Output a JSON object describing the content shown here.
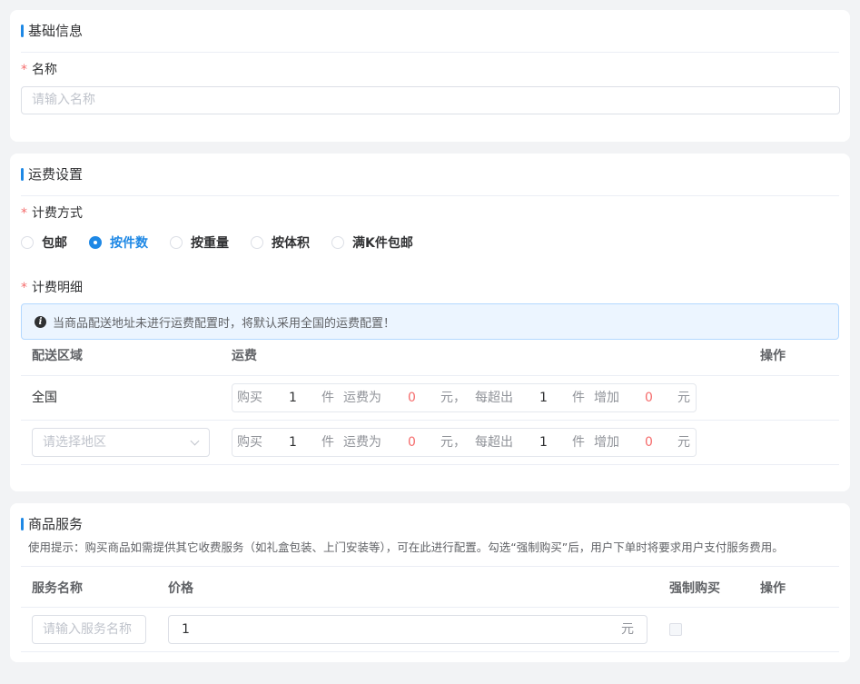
{
  "basic": {
    "title": "基础信息",
    "name_label": "名称",
    "required_mark": "*",
    "name_placeholder": "请输入名称"
  },
  "shipping": {
    "title": "运费设置",
    "billing_method_label": "计费方式",
    "billing_options": [
      {
        "label": "包邮",
        "checked": false
      },
      {
        "label": "按件数",
        "checked": true
      },
      {
        "label": "按重量",
        "checked": false
      },
      {
        "label": "按体积",
        "checked": false
      },
      {
        "label": "满K件包邮",
        "checked": false
      }
    ],
    "detail_label": "计费明细",
    "notice": "当商品配送地址未进行运费配置时，将默认采用全国的运费配置！",
    "table_headers": {
      "region": "配送区域",
      "fee": "运费",
      "action": "操作"
    },
    "rows": [
      {
        "region": "全国",
        "buy_label": "购买",
        "buy_qty": "1",
        "unit": "件",
        "fee_label": "运费为",
        "fee": "0",
        "currency": "元，",
        "each_over_label": "每超出",
        "over_qty": "1",
        "over_unit": "件",
        "add_label": "增加",
        "add_fee": "0",
        "add_currency": "元"
      },
      {
        "region_placeholder": "请选择地区",
        "buy_label": "购买",
        "buy_qty": "1",
        "unit": "件",
        "fee_label": "运费为",
        "fee": "0",
        "currency": "元，",
        "each_over_label": "每超出",
        "over_qty": "1",
        "over_unit": "件",
        "add_label": "增加",
        "add_fee": "0",
        "add_currency": "元"
      }
    ],
    "accent_color": "#1e88e5",
    "value_color": "#f56c6c"
  },
  "services": {
    "title": "商品服务",
    "tip": "使用提示：购买商品如需提供其它收费服务（如礼盒包装、上门安装等），可在此进行配置。勾选“强制购买”后，用户下单时将要求用户支付服务费用。",
    "table_headers": {
      "name": "服务名称",
      "price": "价格",
      "force": "强制购买",
      "action": "操作"
    },
    "row": {
      "name_placeholder": "请输入服务名称",
      "price": "1",
      "price_unit": "元",
      "force_checked": false
    }
  }
}
